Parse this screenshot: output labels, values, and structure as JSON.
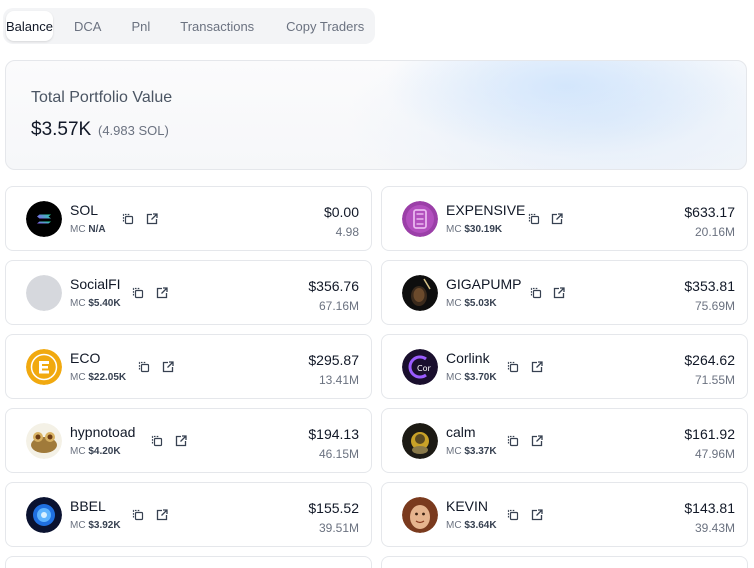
{
  "tabs": [
    {
      "label": "Balance",
      "active": true
    },
    {
      "label": "DCA",
      "active": false
    },
    {
      "label": "Pnl",
      "active": false
    },
    {
      "label": "Transactions",
      "active": false
    },
    {
      "label": "Copy Traders",
      "active": false
    }
  ],
  "portfolio": {
    "label": "Total Portfolio Value",
    "value": "$3.57K",
    "sol": "(4.983 SOL)"
  },
  "colors": {
    "border": "#e5e7eb",
    "muted_text": "#6b7280",
    "text": "#111827"
  },
  "tokens": [
    {
      "name": "SOL",
      "mc_label": "MC",
      "mc": "N/A",
      "usd": "$0.00",
      "amount": "4.98",
      "logo": "solana-logo"
    },
    {
      "name": "EXPENSIVE",
      "mc_label": "MC",
      "mc": "$30.19K",
      "usd": "$633.17",
      "amount": "20.16M",
      "logo": "expensive-logo"
    },
    {
      "name": "SocialFI",
      "mc_label": "MC",
      "mc": "$5.40K",
      "usd": "$356.76",
      "amount": "67.16M",
      "logo": "placeholder-logo"
    },
    {
      "name": "GIGAPUMP",
      "mc_label": "MC",
      "mc": "$5.03K",
      "usd": "$353.81",
      "amount": "75.69M",
      "logo": "gigapump-logo"
    },
    {
      "name": "ECO",
      "mc_label": "MC",
      "mc": "$22.05K",
      "usd": "$295.87",
      "amount": "13.41M",
      "logo": "eco-logo"
    },
    {
      "name": "Corlink",
      "mc_label": "MC",
      "mc": "$3.70K",
      "usd": "$264.62",
      "amount": "71.55M",
      "logo": "corlink-logo"
    },
    {
      "name": "hypnotoad",
      "mc_label": "MC",
      "mc": "$4.20K",
      "usd": "$194.13",
      "amount": "46.15M",
      "logo": "hypnotoad-logo"
    },
    {
      "name": "calm",
      "mc_label": "MC",
      "mc": "$3.37K",
      "usd": "$161.92",
      "amount": "47.96M",
      "logo": "calm-logo"
    },
    {
      "name": "BBEL",
      "mc_label": "MC",
      "mc": "$3.92K",
      "usd": "$155.52",
      "amount": "39.51M",
      "logo": "bbel-logo"
    },
    {
      "name": "KEVIN",
      "mc_label": "MC",
      "mc": "$3.64K",
      "usd": "$143.81",
      "amount": "39.43M",
      "logo": "kevin-logo"
    }
  ],
  "icons": {
    "copy": "copy-icon",
    "external": "external-link-icon"
  }
}
